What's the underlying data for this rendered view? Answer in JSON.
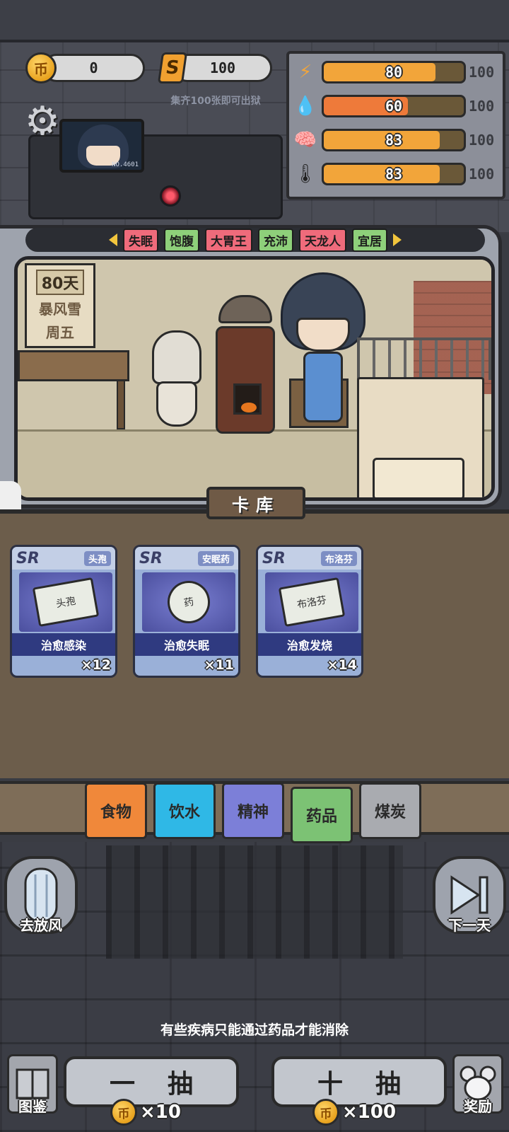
{
  "currency": {
    "coins": "0",
    "tickets": "100",
    "coin_glyph": "币",
    "ticket_glyph": "S"
  },
  "hint_collect": "集齐100张即可出狱",
  "avatar": {
    "number": "NO.4601"
  },
  "stats": [
    {
      "icon": "energy-icon",
      "glyph": "⚡",
      "value": "80",
      "max": "100",
      "level": 0.8,
      "color": "#f2a53a"
    },
    {
      "icon": "water-drop-icon",
      "glyph": "💧",
      "value": "60",
      "max": "100",
      "level": 0.6,
      "color": "#ee7a3a"
    },
    {
      "icon": "brain-icon",
      "glyph": "🧠",
      "value": "83",
      "max": "100",
      "level": 0.83,
      "color": "#f2a53a"
    },
    {
      "icon": "thermometer-icon",
      "glyph": "🌡",
      "value": "83",
      "max": "100",
      "level": 0.83,
      "color": "#f2a53a"
    }
  ],
  "status_tags": [
    {
      "label": "失眠",
      "color": "#ef6b7b"
    },
    {
      "label": "饱腹",
      "color": "#8ed07a"
    },
    {
      "label": "大胃王",
      "color": "#ef6b7b"
    },
    {
      "label": "充沛",
      "color": "#8ed07a"
    },
    {
      "label": "天龙人",
      "color": "#ef6b7b"
    },
    {
      "label": "宜居",
      "color": "#8ed07a"
    }
  ],
  "calendar": {
    "days": "80天",
    "weather": "暴风雪",
    "weekday": "周五"
  },
  "library_label": "卡库",
  "cards": [
    {
      "rarity": "SR",
      "name": "头孢",
      "art_text": "头孢",
      "effect": "治愈感染",
      "count": "×12"
    },
    {
      "rarity": "SR",
      "name": "安眠药",
      "art_text": "药",
      "effect": "治愈失眠",
      "count": "×11"
    },
    {
      "rarity": "SR",
      "name": "布洛芬",
      "art_text": "布洛芬",
      "effect": "治愈发烧",
      "count": "×14"
    }
  ],
  "categories": [
    {
      "label": "食物",
      "color": "#f0883a"
    },
    {
      "label": "饮水",
      "color": "#2fb8e6"
    },
    {
      "label": "精神",
      "color": "#7c7fd8"
    },
    {
      "label": "药品",
      "color": "#7cc274"
    },
    {
      "label": "煤炭",
      "color": "#a9abb0"
    }
  ],
  "buttons": {
    "go_out": "去放风",
    "next_day": "下一天",
    "draw_one": [
      "一",
      "抽"
    ],
    "draw_ten": [
      "十",
      "抽"
    ],
    "draw_one_cost": "×10",
    "draw_ten_cost": "×100",
    "catalog": "图鉴",
    "reward": "奖励"
  },
  "tip": "有些疾病只能通过药品才能消除"
}
